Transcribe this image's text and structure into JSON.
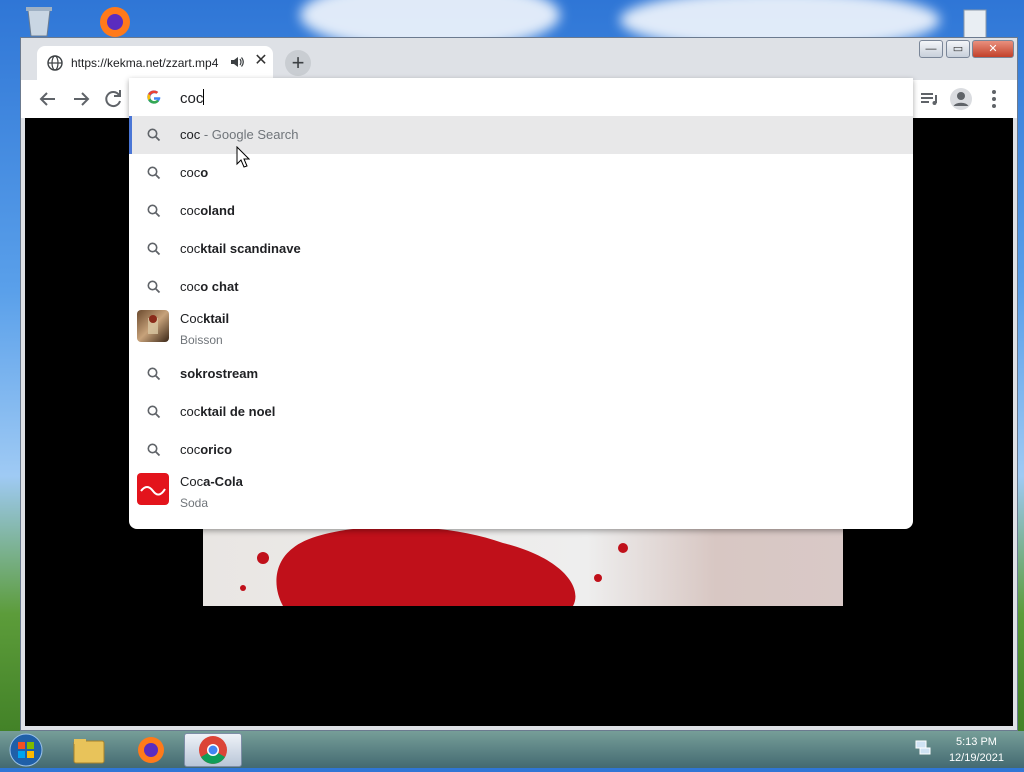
{
  "tab": {
    "title": "https://kekma.net/zzart.mp4",
    "icon": "globe-icon",
    "audio_icon": "speaker-icon",
    "close_glyph": "✕"
  },
  "new_tab_glyph": "+",
  "window_controls": {
    "minimize": "—",
    "maximize": "▭",
    "close": "✕"
  },
  "omnibox": {
    "query": "coc",
    "engine_icon": "google-g-icon",
    "suggestions": [
      {
        "type": "search",
        "typed": "coc",
        "rest": "",
        "hint": " - Google Search",
        "selected": true
      },
      {
        "type": "search",
        "typed": "coc",
        "rest": "o"
      },
      {
        "type": "search",
        "typed": "coc",
        "rest": "oland"
      },
      {
        "type": "search",
        "typed": "coc",
        "rest": "ktail scandinave"
      },
      {
        "type": "search",
        "typed": "coc",
        "rest": "o chat"
      },
      {
        "type": "entity",
        "typed": "Coc",
        "rest": "ktail",
        "subtitle": "Boisson",
        "thumb": "cocktail-thumb"
      },
      {
        "type": "search",
        "typed": "",
        "rest": "sokrostream"
      },
      {
        "type": "search",
        "typed": "coc",
        "rest": "ktail de noel"
      },
      {
        "type": "search",
        "typed": "coc",
        "rest": "orico"
      },
      {
        "type": "entity",
        "typed": "Coc",
        "rest": "a-Cola",
        "subtitle": "Soda",
        "thumb": "coca-cola-thumb"
      }
    ]
  },
  "taskbar": {
    "apps": [
      "file-explorer",
      "firefox",
      "chrome"
    ],
    "active_app": "chrome",
    "time": "5:13 PM",
    "date": "12/19/2021"
  },
  "colors": {
    "accent": "#4a76d6",
    "selected_row": "#e8e8e9",
    "coca_cola_red": "#e3141c"
  }
}
